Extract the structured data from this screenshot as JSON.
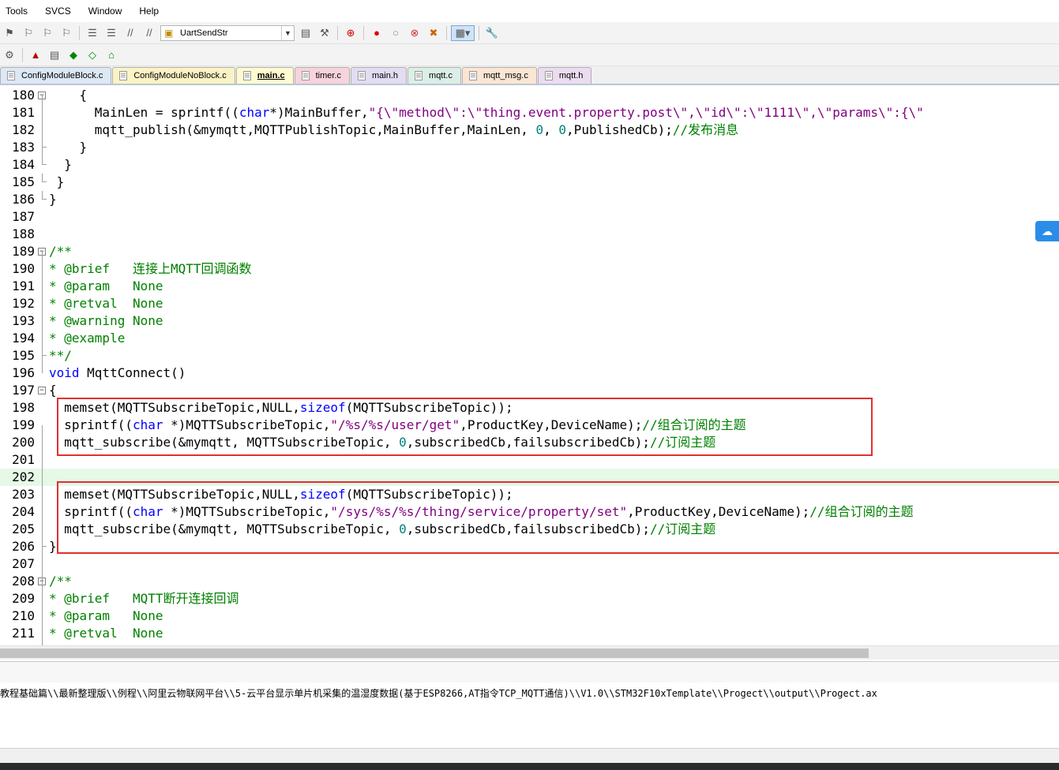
{
  "menu": [
    "Tools",
    "SVCS",
    "Window",
    "Help"
  ],
  "toolbar": {
    "target_name": "UartSendStr"
  },
  "tabs": [
    {
      "label": "ConfigModuleBlock.c",
      "color": "#dde8f5",
      "active": false
    },
    {
      "label": "ConfigModuleNoBlock.c",
      "color": "#fbf3c4",
      "active": false
    },
    {
      "label": "main.c",
      "color": "#fffbd0",
      "active": true
    },
    {
      "label": "timer.c",
      "color": "#f7d3dc",
      "active": false
    },
    {
      "label": "main.h",
      "color": "#e3dcf2",
      "active": false
    },
    {
      "label": "mqtt.c",
      "color": "#dcefe6",
      "active": false
    },
    {
      "label": "mqtt_msg.c",
      "color": "#fbe6d4",
      "active": false
    },
    {
      "label": "mqtt.h",
      "color": "#ecdcf0",
      "active": false
    }
  ],
  "editor": {
    "lines": [
      {
        "n": "180",
        "text": "    {"
      },
      {
        "n": "181",
        "text": "      MainLen = sprintf((char*)MainBuffer,\"{\\\"method\\\":\\\"thing.event.property.post\\\",\\\"id\\\":\\\"1111\\\",\\\"params\\\":{\\\""
      },
      {
        "n": "182",
        "text": "      mqtt_publish(&mymqtt,MQTTPublishTopic,MainBuffer,MainLen, 0, 0,PublishedCb);//发布消息"
      },
      {
        "n": "183",
        "text": "    }"
      },
      {
        "n": "184",
        "text": "  }"
      },
      {
        "n": "185",
        "text": " }"
      },
      {
        "n": "186",
        "text": "}"
      },
      {
        "n": "187",
        "text": ""
      },
      {
        "n": "188",
        "text": ""
      },
      {
        "n": "189",
        "text": "/**"
      },
      {
        "n": "190",
        "text": "* @brief   连接上MQTT回调函数"
      },
      {
        "n": "191",
        "text": "* @param   None"
      },
      {
        "n": "192",
        "text": "* @retval  None"
      },
      {
        "n": "193",
        "text": "* @warning None"
      },
      {
        "n": "194",
        "text": "* @example"
      },
      {
        "n": "195",
        "text": "**/"
      },
      {
        "n": "196",
        "text": "void MqttConnect()"
      },
      {
        "n": "197",
        "text": "{"
      },
      {
        "n": "198",
        "text": "  memset(MQTTSubscribeTopic,NULL,sizeof(MQTTSubscribeTopic));"
      },
      {
        "n": "199",
        "text": "  sprintf((char *)MQTTSubscribeTopic,\"/%s/%s/user/get\",ProductKey,DeviceName);//组合订阅的主题"
      },
      {
        "n": "200",
        "text": "  mqtt_subscribe(&mymqtt, MQTTSubscribeTopic, 0,subscribedCb,failsubscribedCb);//订阅主题"
      },
      {
        "n": "201",
        "text": ""
      },
      {
        "n": "202",
        "text": ""
      },
      {
        "n": "203",
        "text": "  memset(MQTTSubscribeTopic,NULL,sizeof(MQTTSubscribeTopic));"
      },
      {
        "n": "204",
        "text": "  sprintf((char *)MQTTSubscribeTopic,\"/sys/%s/%s/thing/service/property/set\",ProductKey,DeviceName);//组合订阅的主题"
      },
      {
        "n": "205",
        "text": "  mqtt_subscribe(&mymqtt, MQTTSubscribeTopic, 0,subscribedCb,failsubscribedCb);//订阅主题"
      },
      {
        "n": "206",
        "text": "}"
      },
      {
        "n": "207",
        "text": ""
      },
      {
        "n": "208",
        "text": "/**"
      },
      {
        "n": "209",
        "text": "* @brief   MQTT断开连接回调"
      },
      {
        "n": "210",
        "text": "* @param   None"
      },
      {
        "n": "211",
        "text": "* @retval  None"
      }
    ]
  },
  "output": {
    "path_text": "教程基础篇\\\\最新整理版\\\\例程\\\\阿里云物联网平台\\\\5-云平台显示单片机采集的温湿度数据(基于ESP8266,AT指令TCP_MQTT通信)\\\\V1.0\\\\STM32F10xTemplate\\\\Progect\\\\output\\\\Progect.ax"
  },
  "colors": {
    "keyword": "#0000ff",
    "string": "#800080",
    "number": "#008080",
    "comment": "#008000",
    "highlight_box": "#e03030",
    "current_line": "#e6f9e6"
  }
}
